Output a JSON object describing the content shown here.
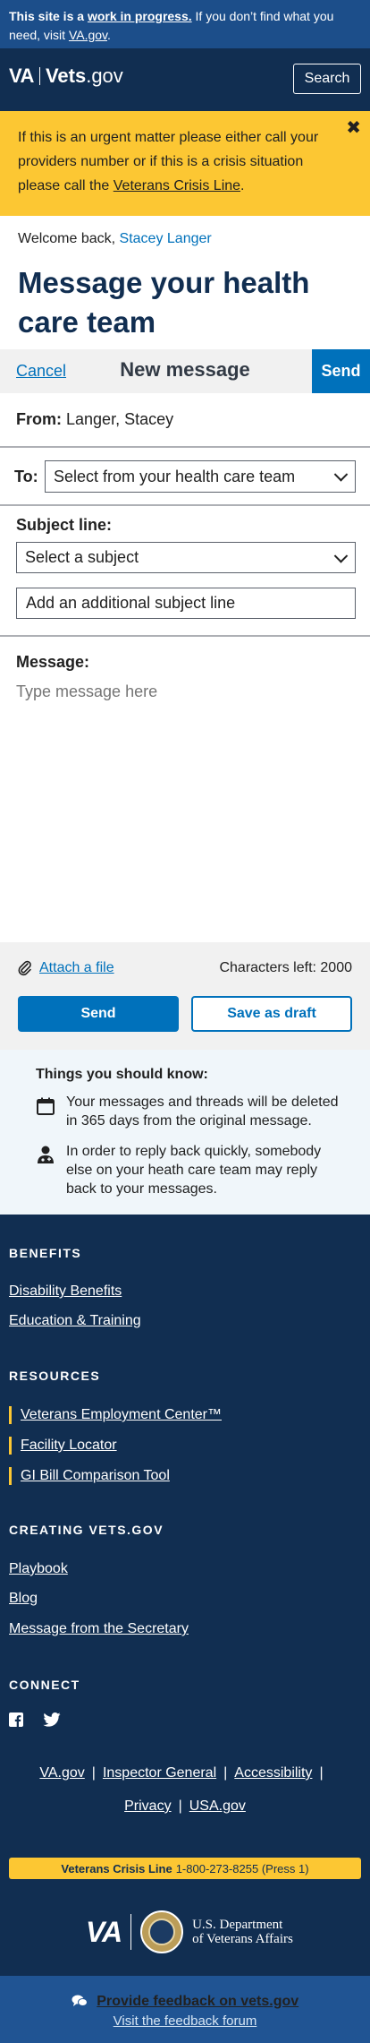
{
  "beta_banner": {
    "lead": "This site is a",
    "wip": "work in progress.",
    "rest": "If you don’t find what you need, visit",
    "link": "VA.gov",
    "end": "."
  },
  "header": {
    "logo_va": "VA",
    "logo_vets": "Vets",
    "logo_gov": ".gov",
    "search_label": "Search"
  },
  "alert": {
    "text": "If this is an urgent matter please either call your providers number or if this is a crisis situation please call  the",
    "link": "Veterans Crisis Line",
    "end": ".",
    "close_glyph": "✖"
  },
  "welcome": {
    "prefix": "Welcome back,",
    "name": "Stacey Langer"
  },
  "page_title": "Message your health care team",
  "compose": {
    "cancel": "Cancel",
    "title": "New message",
    "send": "Send",
    "from_label": "From:",
    "from_value": "Langer, Stacey",
    "to_label": "To:",
    "to_value": "Select from your health care team",
    "subject_label": "Subject line:",
    "subject_value": "Select a subject",
    "additional_subject_placeholder": "Add an additional subject line",
    "message_label": "Message:",
    "message_placeholder": "Type message here"
  },
  "actions": {
    "attach": "Attach a file",
    "chars_left": "Characters left: 2000",
    "send": "Send",
    "save_draft": "Save as draft"
  },
  "know": {
    "title": "Things you should know:",
    "items": [
      {
        "icon": "calendar-icon",
        "text": "Your messages and threads will be deleted in 365 days from the original message."
      },
      {
        "icon": "user-doctor-icon",
        "text": "In order to reply back quickly, somebody else on your heath care team may reply back to your messages."
      }
    ]
  },
  "footer": {
    "benefits_head": "BENEFITS",
    "benefits": [
      "Disability Benefits",
      "Education & Training"
    ],
    "resources_head": "RESOURCES",
    "resources": [
      "Veterans Employment Center™",
      "Facility Locator",
      "GI Bill Comparison Tool"
    ],
    "creating_head": "CREATING VETS.GOV",
    "creating": [
      "Playbook",
      "Blog",
      "Message from the Secretary"
    ],
    "connect_head": "CONNECT",
    "social": {
      "facebook": "facebook-icon",
      "twitter": "twitter-icon"
    },
    "links_row1": [
      "VA.gov",
      "Inspector General",
      "Accessibility"
    ],
    "links_row2": [
      "Privacy",
      "USA.gov"
    ],
    "crisis_label": "Veterans Crisis Line",
    "crisis_number": "1-800-273-8255 (Press 1)",
    "va_mark": "VA",
    "dept_line1": "U.S. Department",
    "dept_line2": "of Veterans Affairs"
  },
  "feedback": {
    "primary": "Provide feedback on vets.gov",
    "secondary": "Visit the feedback forum"
  },
  "colors": {
    "navy": "#112e51",
    "primary_blue": "#0071bb",
    "gold": "#fcc733",
    "beta_blue": "#1c4e8a",
    "feedback_blue": "#205493"
  }
}
